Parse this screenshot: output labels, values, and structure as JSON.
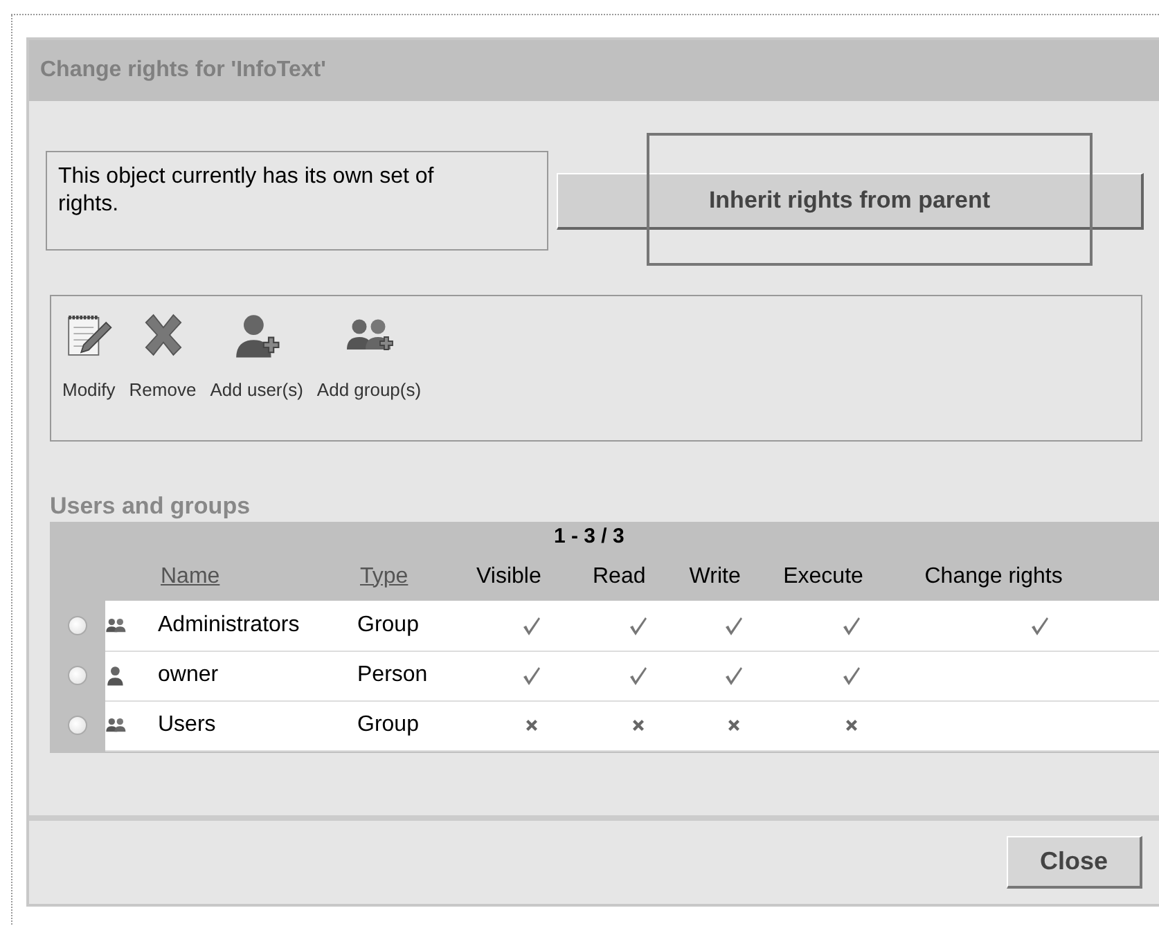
{
  "dialog": {
    "title": "Change rights for 'InfoText'"
  },
  "info": "This object currently has its own set of rights.",
  "inherit_button": "Inherit rights from parent",
  "toolbar": [
    {
      "kind": "modify",
      "label": "Modify"
    },
    {
      "kind": "remove",
      "label": "Remove"
    },
    {
      "kind": "add_user",
      "label": "Add user(s)"
    },
    {
      "kind": "add_group",
      "label": "Add group(s)"
    }
  ],
  "section_title": "Users and groups",
  "table": {
    "pager": "1 - 3 / 3",
    "columns": [
      {
        "label": "Name",
        "kind": "sort"
      },
      {
        "label": "Type",
        "kind": "sort"
      },
      {
        "label": "Visible",
        "kind": "plain"
      },
      {
        "label": "Read",
        "kind": "plain"
      },
      {
        "label": "Write",
        "kind": "plain"
      },
      {
        "label": "Execute",
        "kind": "plain"
      },
      {
        "label": "Change rights",
        "kind": "plain"
      }
    ],
    "rows": [
      {
        "selected": false,
        "kind": "group",
        "name": "Administrators",
        "type": "Group",
        "rights": [
          {
            "kind": "check"
          },
          {
            "kind": "check"
          },
          {
            "kind": "check"
          },
          {
            "kind": "check"
          },
          {
            "kind": "check"
          }
        ]
      },
      {
        "selected": false,
        "kind": "person",
        "name": "owner",
        "type": "Person",
        "rights": [
          {
            "kind": "check"
          },
          {
            "kind": "check"
          },
          {
            "kind": "check"
          },
          {
            "kind": "check"
          },
          {
            "kind": "none"
          }
        ]
      },
      {
        "selected": false,
        "kind": "group",
        "name": "Users",
        "type": "Group",
        "rights": [
          {
            "kind": "cross"
          },
          {
            "kind": "cross"
          },
          {
            "kind": "cross"
          },
          {
            "kind": "cross"
          },
          {
            "kind": "none"
          }
        ]
      }
    ]
  },
  "close_button": "Close"
}
